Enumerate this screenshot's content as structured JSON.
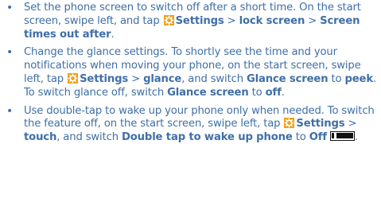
{
  "colors": {
    "text": "#3f6fa6",
    "settings_icon_bg": "#f0a11a",
    "toggle": "#111111"
  },
  "icons": {
    "settings": "gear-icon",
    "toggle": "toggle-off-icon"
  },
  "bullet_char": "•",
  "items": [
    {
      "t1": "Set the phone screen to switch off after a short time. On the start screen, swipe left, and tap ",
      "b1": "Settings",
      "t2": " > ",
      "b2": "lock screen",
      "t3": " > ",
      "b3": "Screen times out after",
      "t4": "."
    },
    {
      "t1": "Change the glance settings. To shortly see the time and your notifications when moving your phone, on the start screen, swipe left, tap ",
      "b1": "Settings",
      "t2": " > ",
      "b2": "glance",
      "t3": ", and switch ",
      "b3": "Glance screen",
      "t4": " to ",
      "b4": "peek",
      "t5": ". To switch glance off, switch ",
      "b5": "Glance screen",
      "t6": " to ",
      "b6": "off",
      "t7": "."
    },
    {
      "t1": "Use double-tap to wake up your phone only when needed. To switch the feature off, on the start screen, swipe left, tap ",
      "b1": "Settings",
      "t2": " > ",
      "b2": "touch",
      "t3": ", and switch ",
      "b3": "Double tap to wake up phone",
      "t4": " to ",
      "b4": "Off",
      "t5": "."
    }
  ]
}
